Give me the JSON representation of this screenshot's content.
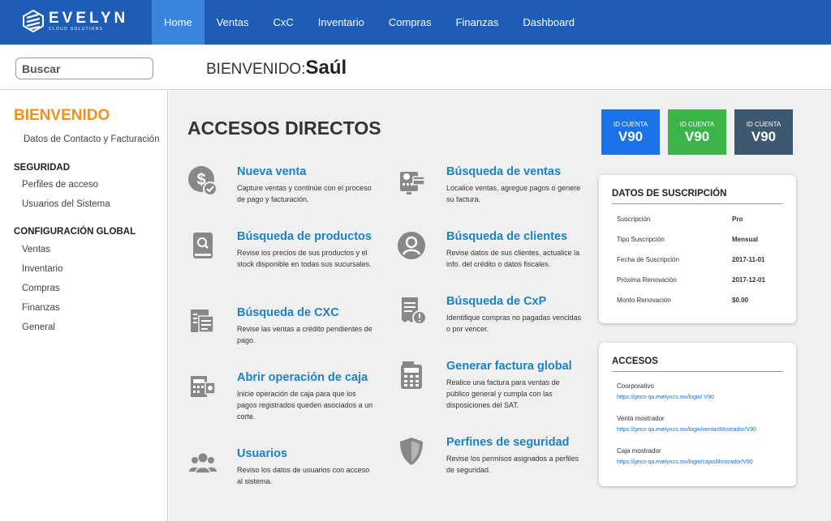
{
  "brand": {
    "name": "EVELYN",
    "tagline": "CLOUD SOLUTIONS"
  },
  "nav": [
    "Home",
    "Ventas",
    "CxC",
    "Inventario",
    "Compras",
    "Finanzas",
    "Dashboard"
  ],
  "search": {
    "placeholder": "Buscar"
  },
  "welcome": {
    "prefix": "BIENVENIDO:",
    "user": "Saúl"
  },
  "sidebar": {
    "title": "BIENVENIDO",
    "contact": "Datos de Contacto y Facturación",
    "security": {
      "heading": "SEGURIDAD",
      "items": [
        "Perfiles de acceso",
        "Usuarios del Sistema"
      ]
    },
    "config": {
      "heading": "CONFIGURACIÓN GLOBAL",
      "items": [
        "Ventas",
        "Inventario",
        "Compras",
        "Finanzas",
        "General"
      ]
    }
  },
  "main": {
    "title": "ACCESOS DIRECTOS"
  },
  "shortcuts": [
    {
      "title": "Nueva venta",
      "desc": "Capture ventas y continúe con el proceso de pago y facturación.",
      "icon": "money-check-icon"
    },
    {
      "title": "Búsqueda de ventas",
      "desc": "Localice ventas, agregue pagos o genere su factura.",
      "icon": "pos-terminal-icon"
    },
    {
      "title": "Búsqueda de productos",
      "desc": "Revise los precios de sus productos  y el stock disponible en todas sus sucursales.",
      "icon": "catalog-search-icon"
    },
    {
      "title": "Búsqueda de clientes",
      "desc": "Revise  datos de sus clientes, actualice la info. del crédito o datos fiscales.",
      "icon": "user-circle-icon"
    },
    {
      "title": "Búsqueda de CXC",
      "desc": "Revise las ventas a crédito pendientes de pago.",
      "icon": "receivables-icon"
    },
    {
      "title": "Búsqueda de CxP",
      "desc": "Identifique compras no pagadas vencidas o por vencer.",
      "icon": "receipt-alert-icon"
    },
    {
      "title": "Abrir operación de caja",
      "desc": "Inicie operación de caja para que los pagos registrados queden asociados a un corte.",
      "icon": "cash-register-icon"
    },
    {
      "title": "Generar  factura global",
      "desc": "Realice una factura para ventas de público general y cumpla con las disposiciones del SAT.",
      "icon": "calculator-icon"
    },
    {
      "title": "Usuarios",
      "desc": "Reviso los datos de usuarios con acceso al sistema.",
      "icon": "users-icon"
    },
    {
      "title": "Perfines de seguridad",
      "desc": "Revise los permisos asignados a perfiles de seguridad.",
      "icon": "shield-icon"
    }
  ],
  "badges": [
    {
      "label": "ID CUENTA",
      "value": "V90",
      "color": "#1a73e8"
    },
    {
      "label": "ID CUENTA",
      "value": "V90",
      "color": "#3bb54a"
    },
    {
      "label": "ID CUENTA",
      "value": "V90",
      "color": "#3e5870"
    }
  ],
  "subscription": {
    "title": "DATOS DE SUSCRIPCIÓN",
    "rows": [
      {
        "k": "Suscripción",
        "v": "Pro"
      },
      {
        "k": "Tipo Suscripción",
        "v": "Mensual"
      },
      {
        "k": "Fecha de Suscripción",
        "v": "2017-11-01"
      },
      {
        "k": "Próxima Renovación",
        "v": "2017-12-01"
      },
      {
        "k": "Monto Renovación",
        "v": "$0.00"
      }
    ]
  },
  "access": {
    "title": "ACCESOS",
    "items": [
      {
        "label": "Coorporativo",
        "url": "https://geco-qa.evelyncs.mx/login/ V90"
      },
      {
        "label": "Venta mostrador",
        "url": "https://geco-qa.evelyncs.mx/login/ventasMostrador/V90"
      },
      {
        "label": "Caja mostrador",
        "url": "https://geco-qa.evelyncs.mx/login/cajasMostrador/V90"
      }
    ]
  },
  "colors": {
    "brand": "#1d5db5",
    "navActive": "#3a85e0",
    "accent": "#f0911d",
    "link": "#1c82c4",
    "icon": "#888888"
  }
}
